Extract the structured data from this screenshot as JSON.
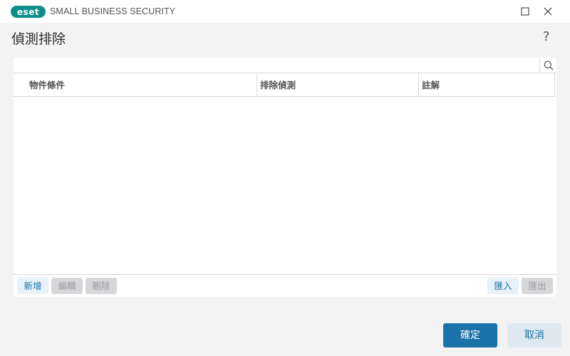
{
  "window": {
    "logo_text": "eset",
    "app_title": "SMALL BUSINESS SECURITY",
    "brand_color": "#0e8e8a"
  },
  "page": {
    "title": "偵測排除",
    "help_label": "?"
  },
  "search": {
    "value": "",
    "placeholder": "",
    "icon": "search-icon"
  },
  "table": {
    "columns": [
      "物件條件",
      "排除偵測",
      "註解"
    ],
    "rows": []
  },
  "toolbar": {
    "add_label": "新增",
    "edit_label": "編輯",
    "delete_label": "刪除",
    "import_label": "匯入",
    "export_label": "匯出"
  },
  "footer": {
    "ok_label": "確定",
    "cancel_label": "取消",
    "accent_color": "#1a73a8"
  }
}
